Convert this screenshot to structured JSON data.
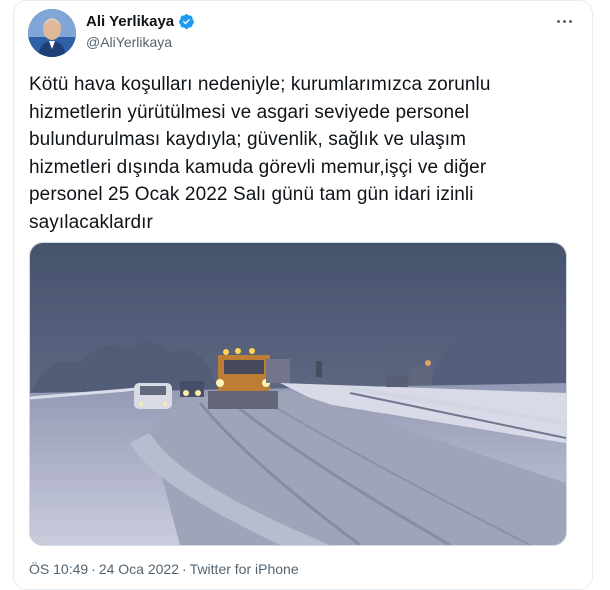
{
  "author": {
    "name": "Ali Yerlikaya",
    "handle": "@AliYerlikaya",
    "verified_icon": "verified-badge-icon",
    "badge_color": "#1d9bf0"
  },
  "more_icon": "more-options-icon",
  "tweet": {
    "lines": [
      "Kötü hava koşulları nedeniyle; kurumlarımızca zorunlu",
      "hizmetlerin yürütülmesi ve asgari seviyede personel",
      "bulundurulması kaydıyla; güvenlik, sağlık ve ulaşım",
      "hizmetleri dışında kamuda görevli memur,işçi ve diğer",
      "personel 25 Ocak 2022 Salı günü tam gün idari izinli",
      "sayılacaklardır"
    ]
  },
  "media": {
    "icon": "snowy-highway-photo"
  },
  "meta": {
    "time": "ÖS 10:49",
    "separator": "·",
    "date": "24 Oca 2022",
    "source": "Twitter for iPhone"
  }
}
